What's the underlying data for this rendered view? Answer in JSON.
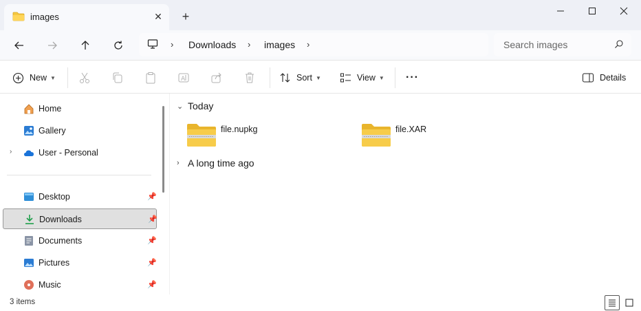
{
  "window": {
    "tab_title": "images",
    "tab_close": "✕",
    "new_tab": "+",
    "minimize": "—",
    "maximize": "☐",
    "close": "✕"
  },
  "address": {
    "breadcrumbs": [
      "Downloads",
      "images"
    ],
    "search_placeholder": "Search images"
  },
  "commands": {
    "new_label": "New",
    "sort_label": "Sort",
    "view_label": "View",
    "more_label": "···",
    "details_label": "Details"
  },
  "sidebar": {
    "items": [
      {
        "label": "Home",
        "icon": "home-icon"
      },
      {
        "label": "Gallery",
        "icon": "gallery-icon"
      },
      {
        "label": "User - Personal",
        "icon": "cloud-icon"
      },
      {
        "label": "Desktop",
        "icon": "desktop-icon"
      },
      {
        "label": "Downloads",
        "icon": "download-icon"
      },
      {
        "label": "Documents",
        "icon": "documents-icon"
      },
      {
        "label": "Pictures",
        "icon": "pictures-icon"
      },
      {
        "label": "Music",
        "icon": "music-icon"
      }
    ]
  },
  "content": {
    "groups": [
      {
        "label": "Today",
        "expanded": true
      },
      {
        "label": "A long time ago",
        "expanded": false
      }
    ],
    "files": [
      {
        "name": "file.nupkg",
        "icon": "zip-folder-icon"
      },
      {
        "name": "file.XAR",
        "icon": "zip-folder-icon"
      }
    ]
  },
  "status": {
    "item_count": "3 items"
  },
  "colors": {
    "titlebar_bg": "#eef0f6",
    "folder_yellow": "#f5c842",
    "selection_bg": "#e0e0e0",
    "download_green": "#1e9e4a"
  }
}
